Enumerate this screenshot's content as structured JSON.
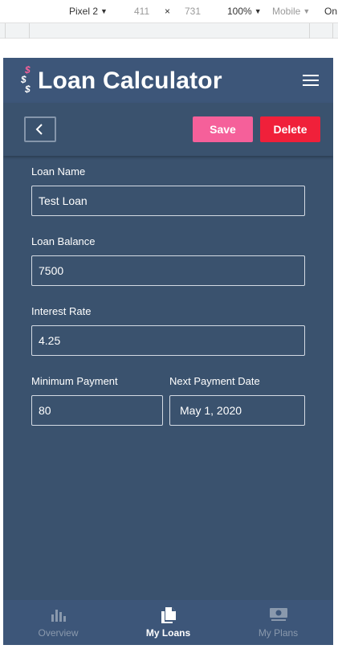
{
  "devtools": {
    "device": "Pixel 2",
    "width": "411",
    "times": "×",
    "height": "731",
    "zoom": "100%",
    "mode": "Mobile",
    "throttle": "On"
  },
  "app": {
    "title": "Loan Calculator",
    "logo_glyph": "$"
  },
  "toolbar": {
    "save_label": "Save",
    "delete_label": "Delete"
  },
  "form": {
    "loan_name": {
      "label": "Loan Name",
      "value": "Test Loan"
    },
    "loan_balance": {
      "label": "Loan Balance",
      "value": "7500"
    },
    "interest_rate": {
      "label": "Interest Rate",
      "value": "4.25"
    },
    "minimum_payment": {
      "label": "Minimum Payment",
      "value": "80"
    },
    "next_payment_date": {
      "label": "Next Payment Date",
      "value": "May 1, 2020"
    }
  },
  "bottom_nav": {
    "items": [
      {
        "label": "Overview",
        "icon": "bar-chart-icon",
        "active": false
      },
      {
        "label": "My Loans",
        "icon": "documents-icon",
        "active": true
      },
      {
        "label": "My Plans",
        "icon": "money-icon",
        "active": false
      }
    ]
  },
  "colors": {
    "app_bg": "#3a526e",
    "header_bg": "#3d5679",
    "save": "#f5609a",
    "delete": "#f0203a",
    "logo_pink": "#f5609a"
  }
}
